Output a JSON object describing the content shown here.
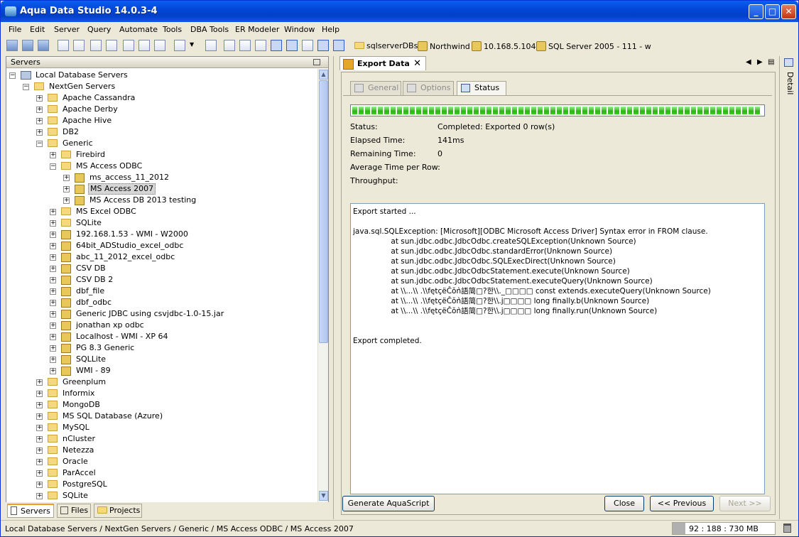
{
  "window": {
    "title": "Aqua Data Studio 14.0.3-4"
  },
  "menu": [
    "File",
    "Edit",
    "Server",
    "Query",
    "Automate",
    "Tools",
    "DBA Tools",
    "ER Modeler",
    "Window",
    "Help"
  ],
  "connections": [
    "sqlserverDBs",
    "Northwind",
    "10.168.5.104",
    "SQL Server 2005 - 111 - w"
  ],
  "servers_panel": {
    "title": "Servers"
  },
  "tree": [
    {
      "label": "Local Database Servers",
      "depth": 0,
      "icon": "server-root-icon",
      "exp": "-"
    },
    {
      "label": "NextGen Servers",
      "depth": 1,
      "icon": "folder-open-icon",
      "exp": "-"
    },
    {
      "label": "Apache Cassandra",
      "depth": 2,
      "icon": "folder-icon",
      "exp": "+"
    },
    {
      "label": "Apache Derby",
      "depth": 2,
      "icon": "folder-icon",
      "exp": "+"
    },
    {
      "label": "Apache Hive",
      "depth": 2,
      "icon": "folder-icon",
      "exp": "+"
    },
    {
      "label": "DB2",
      "depth": 2,
      "icon": "folder-icon",
      "exp": "+"
    },
    {
      "label": "Generic",
      "depth": 2,
      "icon": "folder-open-icon",
      "exp": "-"
    },
    {
      "label": "Firebird",
      "depth": 3,
      "icon": "folder-icon",
      "exp": "+"
    },
    {
      "label": "MS Access ODBC",
      "depth": 3,
      "icon": "folder-open-icon",
      "exp": "-"
    },
    {
      "label": "ms_access_11_2012",
      "depth": 4,
      "icon": "database-icon",
      "exp": "+"
    },
    {
      "label": "MS Access 2007",
      "depth": 4,
      "icon": "database-icon",
      "exp": "+",
      "selected": true
    },
    {
      "label": "MS Access DB 2013 testing",
      "depth": 4,
      "icon": "database-icon",
      "exp": "+"
    },
    {
      "label": "MS Excel ODBC",
      "depth": 3,
      "icon": "folder-icon",
      "exp": "+"
    },
    {
      "label": "SQLite",
      "depth": 3,
      "icon": "folder-icon",
      "exp": "+"
    },
    {
      "label": "192.168.1.53 - WMI - W2000",
      "depth": 3,
      "icon": "database-icon",
      "exp": "+"
    },
    {
      "label": "64bit_ADStudio_excel_odbc",
      "depth": 3,
      "icon": "database-icon",
      "exp": "+"
    },
    {
      "label": "abc_11_2012_excel_odbc",
      "depth": 3,
      "icon": "database-icon",
      "exp": "+"
    },
    {
      "label": "CSV DB",
      "depth": 3,
      "icon": "database-icon",
      "exp": "+"
    },
    {
      "label": "CSV DB 2",
      "depth": 3,
      "icon": "database-icon",
      "exp": "+"
    },
    {
      "label": "dbf_file",
      "depth": 3,
      "icon": "database-icon",
      "exp": "+"
    },
    {
      "label": "dbf_odbc",
      "depth": 3,
      "icon": "database-icon",
      "exp": "+"
    },
    {
      "label": "Generic JDBC using csvjdbc-1.0-15.jar",
      "depth": 3,
      "icon": "database-icon",
      "exp": "+"
    },
    {
      "label": "jonathan xp odbc",
      "depth": 3,
      "icon": "database-icon",
      "exp": "+"
    },
    {
      "label": "Localhost - WMI - XP 64",
      "depth": 3,
      "icon": "database-icon",
      "exp": "+"
    },
    {
      "label": "PG 8.3 Generic",
      "depth": 3,
      "icon": "database-icon",
      "exp": "+"
    },
    {
      "label": "SQLLite",
      "depth": 3,
      "icon": "database-icon",
      "exp": "+"
    },
    {
      "label": "WMI - 89",
      "depth": 3,
      "icon": "database-icon",
      "exp": "+"
    },
    {
      "label": "Greenplum",
      "depth": 2,
      "icon": "folder-icon",
      "exp": "+"
    },
    {
      "label": "Informix",
      "depth": 2,
      "icon": "folder-icon",
      "exp": "+"
    },
    {
      "label": "MongoDB",
      "depth": 2,
      "icon": "folder-icon",
      "exp": "+"
    },
    {
      "label": "MS SQL Database (Azure)",
      "depth": 2,
      "icon": "folder-icon",
      "exp": "+"
    },
    {
      "label": "MySQL",
      "depth": 2,
      "icon": "folder-icon",
      "exp": "+"
    },
    {
      "label": "nCluster",
      "depth": 2,
      "icon": "folder-icon",
      "exp": "+"
    },
    {
      "label": "Netezza",
      "depth": 2,
      "icon": "folder-icon",
      "exp": "+"
    },
    {
      "label": "Oracle",
      "depth": 2,
      "icon": "folder-icon",
      "exp": "+"
    },
    {
      "label": "ParAccel",
      "depth": 2,
      "icon": "folder-icon",
      "exp": "+"
    },
    {
      "label": "PostgreSQL",
      "depth": 2,
      "icon": "folder-icon",
      "exp": "+"
    },
    {
      "label": "SQLite",
      "depth": 2,
      "icon": "folder-icon",
      "exp": "+"
    }
  ],
  "bottom_tabs": {
    "servers": "Servers",
    "files": "Files",
    "projects": "Projects"
  },
  "doc_tab": {
    "label": "Export Data",
    "close": "✕"
  },
  "sub_tabs": {
    "general": "General",
    "options": "Options",
    "status": "Status"
  },
  "status": {
    "status_label": "Status:",
    "status_value": "Completed: Exported 0 row(s)",
    "elapsed_label": "Elapsed Time:",
    "elapsed_value": "141ms",
    "remaining_label": "Remaining Time:",
    "remaining_value": "0",
    "avg_label": "Average Time per Row:",
    "throughput_label": "Throughput:",
    "progress": 1.0
  },
  "log": "Export started ...\n\njava.sql.SQLException: [Microsoft][ODBC Microsoft Access Driver] Syntax error in FROM clause.\n                at sun.jdbc.odbc.JdbcOdbc.createSQLException(Unknown Source)\n                at sun.jdbc.odbc.JdbcOdbc.standardError(Unknown Source)\n                at sun.jdbc.odbc.JdbcOdbc.SQLExecDirect(Unknown Source)\n                at sun.jdbc.odbc.JdbcOdbcStatement.execute(Unknown Source)\n                at sun.jdbc.odbc.JdbcOdbcStatement.executeQuery(Unknown Source)\n                at \\\\...\\\\ .\\\\fętçëČŏǹ語简□?한\\\\._□□□□ const extends.executeQuery(Unknown Source)\n                at \\\\...\\\\ .\\\\fętçëČŏǹ語简□?한\\\\.j□□□□ long finally.b(Unknown Source)\n                at \\\\...\\\\ .\\\\fętçëČŏǹ語简□?한\\\\.j□□□□ long finally.run(Unknown Source)\n\n\nExport completed.",
  "buttons": {
    "generate": "Generate AquaScript",
    "close": "Close",
    "previous": "<< Previous",
    "next": "Next >>"
  },
  "detail_label": "Detail",
  "statusbar": {
    "path": "Local Database Servers / NextGen Servers / Generic / MS Access ODBC / MS Access 2007",
    "memory": "92 : 188 : 730 MB",
    "memory_fraction": 0.126
  }
}
